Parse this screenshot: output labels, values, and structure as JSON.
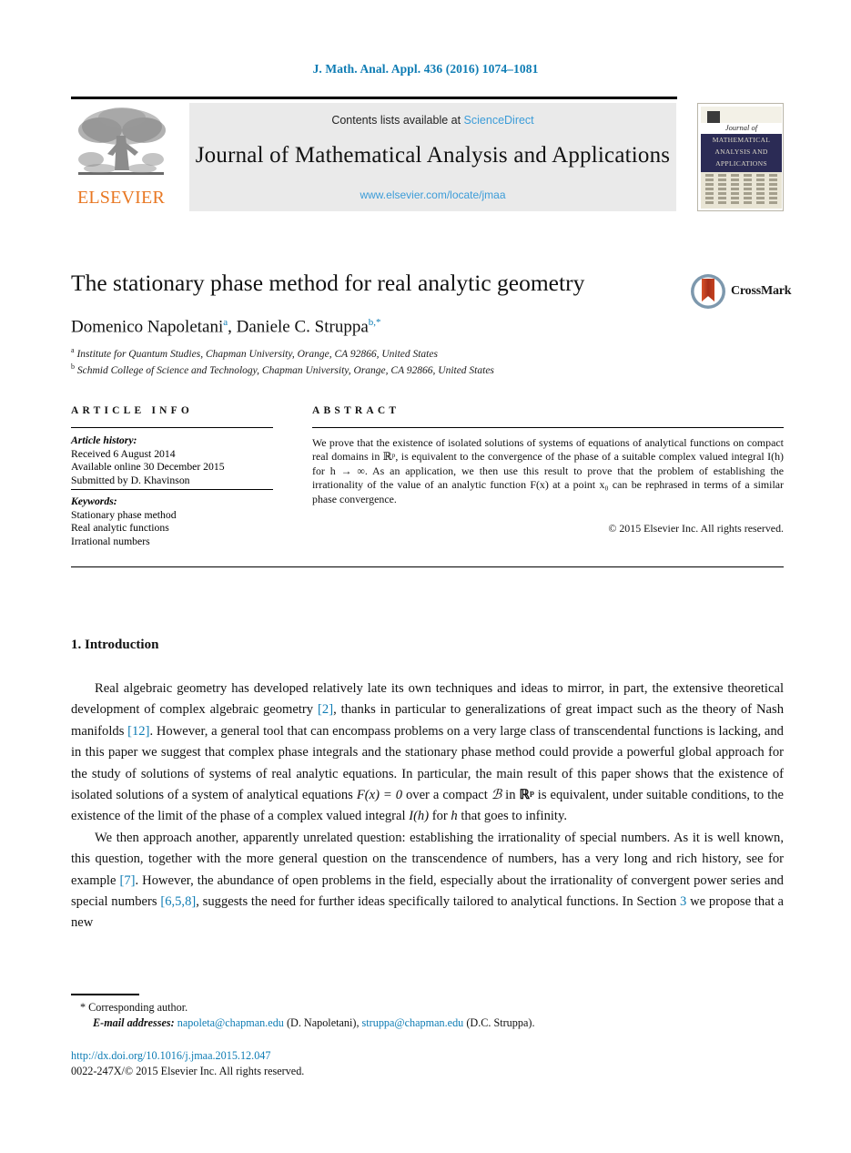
{
  "running_head": "J. Math. Anal. Appl. 436 (2016) 1074–1081",
  "masthead": {
    "contents_prefix": "Contents lists available at ",
    "sciencedirect": "ScienceDirect",
    "journal_title": "Journal of Mathematical Analysis and Applications",
    "journal_url": "www.elsevier.com/locate/jmaa",
    "publisher_wordmark": "ELSEVIER",
    "publisher_logo_icon": "elsevier-tree-icon"
  },
  "cover": {
    "journal_of": "Journal of",
    "line1": "MATHEMATICAL",
    "line2": "ANALYSIS AND",
    "line3": "APPLICATIONS"
  },
  "article": {
    "title": "The stationary phase method for real analytic geometry",
    "crossmark_label": "CrossMark",
    "authors": [
      {
        "name": "Domenico Napoletani",
        "sup": "a"
      },
      {
        "name": "Daniele C. Struppa",
        "sup": "b,*"
      }
    ],
    "author_line_separator": ", ",
    "affiliations": [
      {
        "marker": "a",
        "text": "Institute for Quantum Studies, Chapman University, Orange, CA 92866, United States"
      },
      {
        "marker": "b",
        "text": "Schmid College of Science and Technology, Chapman University, Orange, CA 92866, United States"
      }
    ]
  },
  "info": {
    "heading": "ARTICLE INFO",
    "history_label": "Article history:",
    "history": [
      "Received 6 August 2014",
      "Available online 30 December 2015",
      "Submitted by D. Khavinson"
    ],
    "keywords_label": "Keywords:",
    "keywords": [
      "Stationary phase method",
      "Real analytic functions",
      "Irrational numbers"
    ]
  },
  "abstract": {
    "heading": "ABSTRACT",
    "text": "We prove that the existence of isolated solutions of systems of equations of analytical functions on compact real domains in ℝᵖ, is equivalent to the convergence of the phase of a suitable complex valued integral I(h) for h → ∞. As an application, we then use this result to prove that the problem of establishing the irrationality of the value of an analytic function F(x) at a point x₀ can be rephrased in terms of a similar phase convergence.",
    "copyright": "© 2015 Elsevier Inc. All rights reserved."
  },
  "body": {
    "section_number_title": "1. Introduction",
    "paragraph1_part1": "Real algebraic geometry has developed relatively late its own techniques and ideas to mirror, in part, the extensive theoretical development of complex algebraic geometry ",
    "ref_2": "[2]",
    "paragraph1_part2": ", thanks in particular to generalizations of great impact such as the theory of Nash manifolds ",
    "ref_12": "[12]",
    "paragraph1_part3": ". However, a general tool that can encompass problems on a very large class of transcendental functions is lacking, and in this paper we suggest that complex phase integrals and the stationary phase method could provide a powerful global approach for the study of solutions of systems of real analytic equations. In particular, the main result of this paper shows that the existence of isolated solutions of a system of analytical equations ",
    "eq_F_x_0": "F(x) = 0",
    "paragraph1_part4": " over a compact ",
    "compact_B": "ℬ",
    "paragraph1_part5": " in ",
    "space_Rp": "ℝᵖ",
    "paragraph1_part6": " is equivalent, under suitable conditions, to the existence of the limit of the phase of a complex valued integral ",
    "integral_Ih": "I(h)",
    "paragraph1_part7": " for ",
    "var_h": "h",
    "paragraph1_part8": " that goes to infinity.",
    "paragraph2_part1": "We then approach another, apparently unrelated question: establishing the irrationality of special numbers. As it is well known, this question, together with the more general question on the transcendence of numbers, has a very long and rich history, see for example ",
    "ref_7": "[7]",
    "paragraph2_part2": ". However, the abundance of open problems in the field, especially about the irrationality of convergent power series and special numbers ",
    "ref_658": "[6,5,8]",
    "paragraph2_part3": ", suggests the need for further ideas specifically tailored to analytical functions. In Section ",
    "ref_section3": "3",
    "paragraph2_part4": " we propose that a new"
  },
  "footer": {
    "corresponding_marker": "*",
    "corresponding_text": "Corresponding author.",
    "email_label": "E-mail addresses:",
    "emails": [
      {
        "address": "napoleta@chapman.edu",
        "owner": "(D. Napoletani)"
      },
      {
        "address": "struppa@chapman.edu",
        "owner": "(D.C. Struppa)"
      }
    ],
    "doi": "http://dx.doi.org/10.1016/j.jmaa.2015.12.047",
    "issn_line": "0022-247X/© 2015 Elsevier Inc. All rights reserved."
  },
  "colors": {
    "link_blue": "#0e7cb4",
    "light_blue": "#3c9cd8",
    "elsevier_orange": "#e87722",
    "masthead_gray": "#eaeaea",
    "cover_navy": "#2b2b55"
  }
}
